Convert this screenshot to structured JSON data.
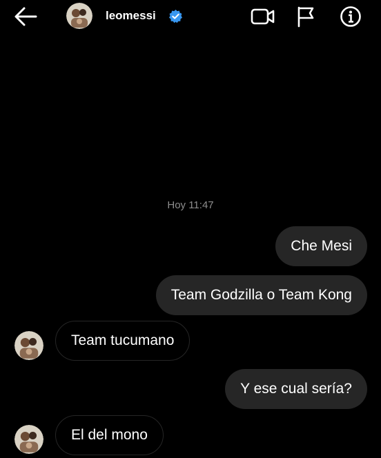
{
  "header": {
    "username": "leomessi",
    "icons": [
      "back-arrow-icon",
      "verified-badge-icon",
      "video-call-icon",
      "flag-icon",
      "info-icon"
    ]
  },
  "colors": {
    "background": "#000000",
    "sent_bubble": "#262626",
    "received_border": "#262626",
    "timestamp": "#8e8e8e",
    "verified_blue": "#3897f0"
  },
  "thread": {
    "timestamp": "Hoy 11:47",
    "messages": [
      {
        "direction": "sent",
        "text": "Che Mesi"
      },
      {
        "direction": "sent",
        "text": "Team Godzilla o Team Kong"
      },
      {
        "direction": "received",
        "text": "Team tucumano"
      },
      {
        "direction": "sent",
        "text": "Y ese cual sería?"
      },
      {
        "direction": "received",
        "text": "El del mono"
      }
    ]
  }
}
